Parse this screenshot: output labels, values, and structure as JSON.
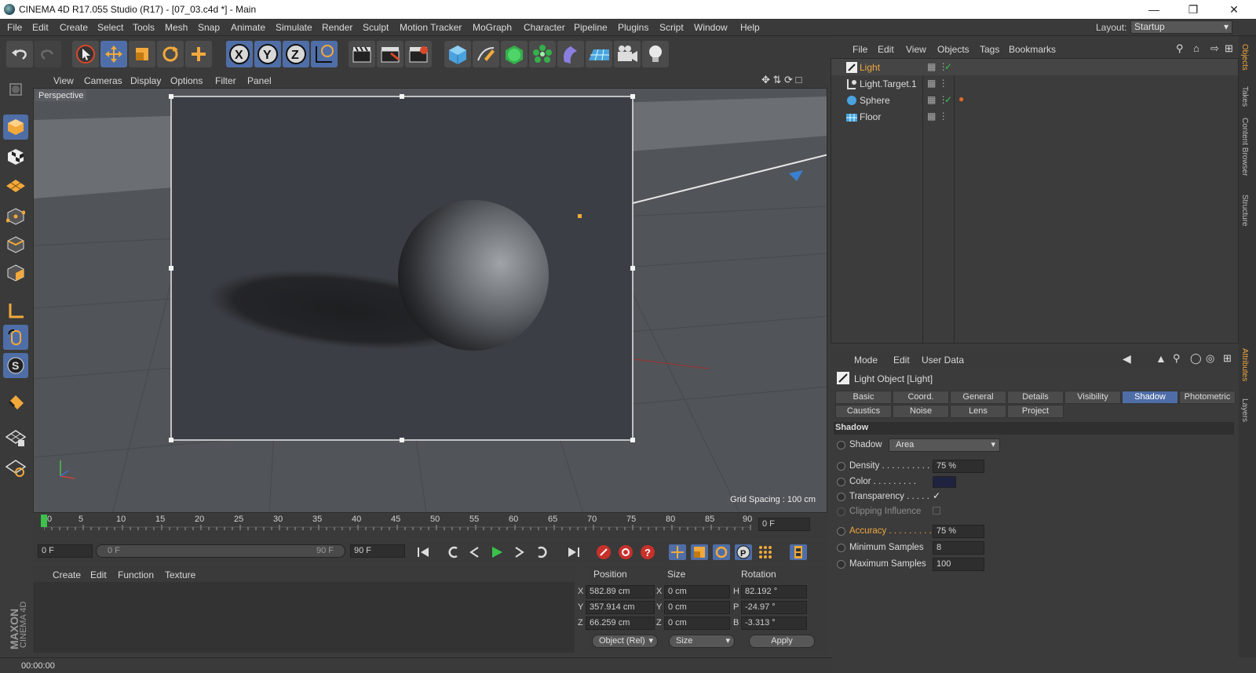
{
  "window": {
    "title": "CINEMA 4D R17.055 Studio (R17) - [07_03.c4d *] - Main"
  },
  "menu": {
    "items": [
      "File",
      "Edit",
      "Create",
      "Select",
      "Tools",
      "Mesh",
      "Snap",
      "Animate",
      "Simulate",
      "Render",
      "Sculpt",
      "Motion Tracker",
      "MoGraph",
      "Character",
      "Pipeline",
      "Plugins",
      "Script",
      "Window",
      "Help"
    ],
    "layout_label": "Layout:",
    "layout_value": "Startup"
  },
  "viewport": {
    "menu": [
      "View",
      "Cameras",
      "Display",
      "Options",
      "Filter",
      "Panel"
    ],
    "label": "Perspective",
    "grid_spacing": "Grid Spacing : 100 cm"
  },
  "timeline": {
    "ticks": [
      "0",
      "5",
      "10",
      "15",
      "20",
      "25",
      "30",
      "35",
      "40",
      "45",
      "50",
      "55",
      "60",
      "65",
      "70",
      "75",
      "80",
      "85",
      "90"
    ],
    "end_field": "0 F"
  },
  "transport": {
    "current": "0 F",
    "range_start": "0 F",
    "range_end": "90 F",
    "max": "90 F"
  },
  "materials": {
    "menu": [
      "Create",
      "Edit",
      "Function",
      "Texture"
    ]
  },
  "coords": {
    "headers": [
      "Position",
      "Size",
      "Rotation"
    ],
    "rows": [
      {
        "axis": "X",
        "pos": "582.89 cm",
        "size_axis": "X",
        "size": "0 cm",
        "rot_axis": "H",
        "rot": "82.192 °"
      },
      {
        "axis": "Y",
        "pos": "357.914 cm",
        "size_axis": "Y",
        "size": "0 cm",
        "rot_axis": "P",
        "rot": "-24.97 °"
      },
      {
        "axis": "Z",
        "pos": "66.259 cm",
        "size_axis": "Z",
        "size": "0 cm",
        "rot_axis": "B",
        "rot": "-3.313 °"
      }
    ],
    "mode": "Object (Rel)",
    "size_mode": "Size",
    "apply": "Apply"
  },
  "status": {
    "time": "00:00:00"
  },
  "objects_panel": {
    "menu": [
      "File",
      "Edit",
      "View",
      "Objects",
      "Tags",
      "Bookmarks"
    ],
    "items": [
      {
        "name": "Light",
        "selected": true
      },
      {
        "name": "Light.Target.1",
        "selected": false
      },
      {
        "name": "Sphere",
        "selected": false
      },
      {
        "name": "Floor",
        "selected": false
      }
    ]
  },
  "attributes": {
    "menu": [
      "Mode",
      "Edit",
      "User Data"
    ],
    "title": "Light Object [Light]",
    "tabs_row1": [
      "Basic",
      "Coord.",
      "General",
      "Details",
      "Visibility",
      "Shadow",
      "Photometric"
    ],
    "tabs_row2": [
      "Caustics",
      "Noise",
      "Lens",
      "Project"
    ],
    "active_tab": "Shadow",
    "section": "Shadow",
    "shadow_label": "Shadow",
    "shadow_value": "Area",
    "density_label": "Density . . . . . . . . . .",
    "density_value": "75 %",
    "color_label": "Color . . . . . . . . .",
    "color_value": "#1f2340",
    "transparency_label": "Transparency . . . . .",
    "clipping_label": "Clipping Influence",
    "accuracy_label": "Accuracy . . . . . . . . .",
    "accuracy_value": "75 %",
    "min_samples_label": "Minimum Samples",
    "min_samples_value": "8",
    "max_samples_label": "Maximum Samples",
    "max_samples_value": "100"
  },
  "side_tabs": [
    "Objects",
    "Takes",
    "Content Browser",
    "Structure",
    "Attributes",
    "Layers"
  ],
  "brand": {
    "line1": "MAXON",
    "line2": "CINEMA 4D"
  }
}
